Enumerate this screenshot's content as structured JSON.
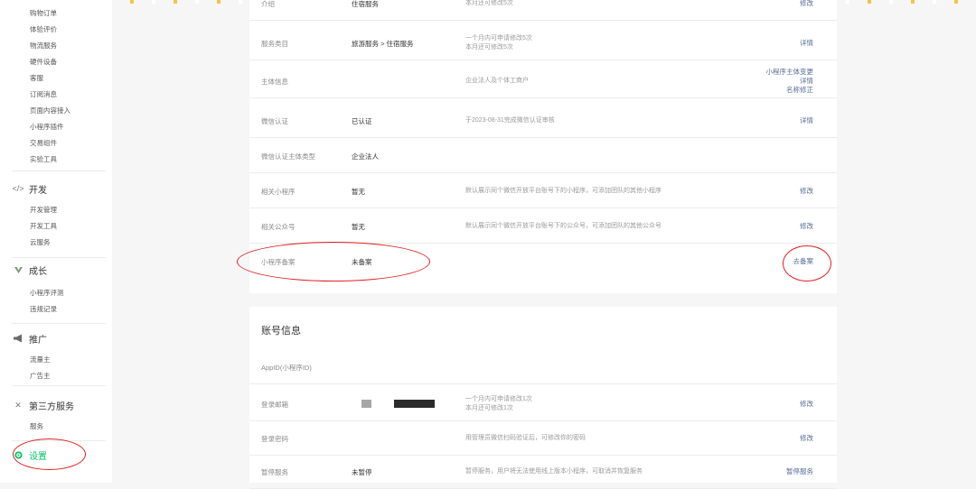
{
  "colors": {
    "accent_green": "#07c160",
    "link_blue": "#576b95",
    "annotation_red": "#e02020",
    "top_strip": [
      "#f6c443",
      "#ffffff"
    ]
  },
  "sidebar": {
    "items_top": [
      "购物订单",
      "体验评价",
      "物流服务",
      "硬件设备",
      "客服",
      "订阅消息",
      "页面内容接入",
      "小程序插件",
      "交易组件",
      "实验工具"
    ],
    "sections": [
      {
        "icon": "code-icon",
        "label": "开发",
        "items": [
          "开发管理",
          "开发工具",
          "云服务"
        ]
      },
      {
        "icon": "growth-icon",
        "label": "成长",
        "items": [
          "小程序评测",
          "违规记录"
        ]
      },
      {
        "icon": "megaphone-icon",
        "label": "推广",
        "items": [
          "流量主",
          "广告主"
        ]
      },
      {
        "icon": "third-party-icon",
        "label": "第三方服务",
        "items": [
          "服务"
        ]
      },
      {
        "icon": "settings-icon",
        "label": "设置",
        "items": [],
        "active": true
      }
    ]
  },
  "basic_info": {
    "rows": [
      {
        "label": "介绍",
        "value": "住宿服务",
        "desc": [
          "本月还可修改5次"
        ],
        "actions": [
          "修改"
        ]
      },
      {
        "label": "服务类目",
        "value": "旅游服务 > 住宿服务",
        "desc": [
          "一个月内可申请修改5次",
          "本月还可修改5次"
        ],
        "actions": [
          "详情"
        ]
      },
      {
        "label": "主体信息",
        "value": "",
        "desc": [
          "企业法人及个体工商户"
        ],
        "actions": [
          "小程序主体变更",
          "详情",
          "名称修正"
        ]
      },
      {
        "label": "微信认证",
        "value": "已认证",
        "desc": [
          "于2023-08-31完成微信认证审核"
        ],
        "actions": [
          "详情"
        ]
      },
      {
        "label": "微信认证主体类型",
        "value": "企业法人",
        "desc": [],
        "actions": []
      },
      {
        "label": "相关小程序",
        "value": "暂无",
        "desc": [
          "默认展示同个微信开放平台账号下的小程序，可添加团队的其他小程序"
        ],
        "actions": [
          "修改"
        ]
      },
      {
        "label": "相关公众号",
        "value": "暂无",
        "desc": [
          "默认展示同个微信开放平台账号下的公众号，可添加团队的其他公众号"
        ],
        "actions": [
          "修改"
        ]
      },
      {
        "label": "小程序备案",
        "value": "未备案",
        "desc": [],
        "actions": [
          "去备案"
        ]
      }
    ]
  },
  "account_info": {
    "title": "账号信息",
    "rows": [
      {
        "label": "AppID(小程序ID)",
        "value": "",
        "desc": [],
        "actions": []
      },
      {
        "label": "登录邮箱",
        "value": "",
        "desc": [
          "一个月内可申请修改1次",
          "本月还可修改1次"
        ],
        "actions": [
          "修改"
        ]
      },
      {
        "label": "登录密码",
        "value": "",
        "desc": [
          "用管理员微信扫码验证后，可修改你的密码"
        ],
        "actions": [
          "修改"
        ]
      },
      {
        "label": "暂停服务",
        "value": "未暂停",
        "desc": [
          "暂停服务，用户将无法使用线上版本小程序，可取消并恢复服务"
        ],
        "actions": [
          "暂停服务"
        ]
      }
    ]
  }
}
